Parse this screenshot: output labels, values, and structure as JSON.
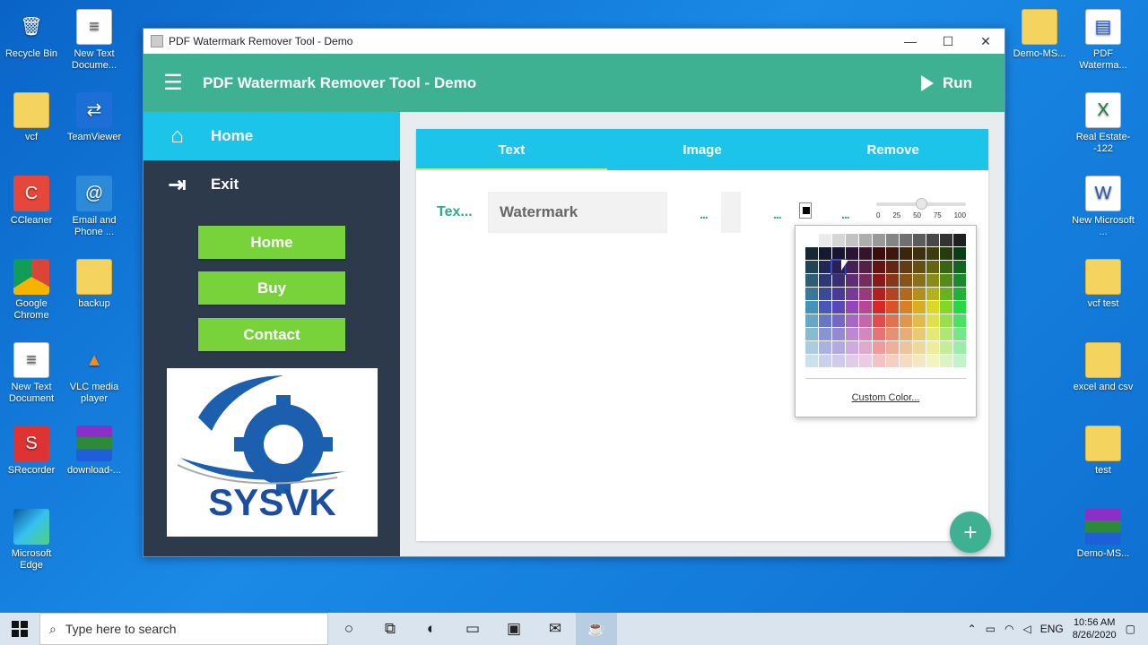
{
  "desktop": {
    "left_icons": [
      {
        "label": "Recycle Bin",
        "icon": "recycle-bin-icon"
      },
      {
        "label": "New Text Docume...",
        "icon": "text-document-icon"
      },
      {
        "label": "vcf",
        "icon": "folder-icon"
      },
      {
        "label": "TeamViewer",
        "icon": "teamviewer-icon"
      },
      {
        "label": "CCleaner",
        "icon": "ccleaner-icon"
      },
      {
        "label": "Email and Phone ...",
        "icon": "email-icon"
      },
      {
        "label": "Google Chrome",
        "icon": "chrome-icon"
      },
      {
        "label": "backup",
        "icon": "folder-icon"
      },
      {
        "label": "New Text Document",
        "icon": "text-document-icon"
      },
      {
        "label": "VLC media player",
        "icon": "vlc-icon"
      },
      {
        "label": "SRecorder",
        "icon": "srecorder-icon"
      },
      {
        "label": "download-...",
        "icon": "winrar-icon"
      },
      {
        "label": "Microsoft Edge",
        "icon": "edge-icon"
      }
    ],
    "right_icons": [
      {
        "label": "Demo-MS...",
        "icon": "folder-icon"
      },
      {
        "label": "PDF Waterma...",
        "icon": "pdf-icon"
      },
      {
        "label": "Real Estate--122",
        "icon": "excel-icon"
      },
      {
        "label": "New Microsoft ...",
        "icon": "word-icon"
      },
      {
        "label": "vcf test",
        "icon": "folder-icon"
      },
      {
        "label": "excel and csv",
        "icon": "folder-icon"
      },
      {
        "label": "test",
        "icon": "folder-icon"
      },
      {
        "label": "Demo-MS...",
        "icon": "winrar-icon"
      }
    ]
  },
  "window": {
    "title": "PDF Watermark Remover Tool - Demo",
    "controls": {
      "minimize": "—",
      "maximize": "☐",
      "close": "✕"
    }
  },
  "appbar": {
    "title": "PDF Watermark Remover Tool - Demo",
    "run_label": "Run"
  },
  "sidebar": {
    "nav": [
      {
        "label": "Home",
        "icon": "home-icon"
      },
      {
        "label": "Exit",
        "icon": "exit-icon"
      }
    ],
    "buttons": {
      "home": "Home",
      "buy": "Buy",
      "contact": "Contact"
    },
    "logo_text": "SYSVK"
  },
  "tabs": [
    {
      "label": "Text"
    },
    {
      "label": "Image"
    },
    {
      "label": "Remove"
    }
  ],
  "text_tab": {
    "field_label": "Tex...",
    "watermark_value": "Watermark",
    "more_1": "...",
    "more_2": "...",
    "more_3": "...",
    "selected_color": "#000000",
    "opacity": 0.5,
    "slider_ticks": [
      "0",
      "25",
      "50",
      "75",
      "100"
    ]
  },
  "palette": {
    "custom_color_label": "Custom Color...",
    "selected_color": "#1d2a8c"
  },
  "fab_label": "+",
  "taskbar": {
    "search_placeholder": "Type here to search",
    "tray_language": "ENG",
    "time": "10:56 AM",
    "date": "8/26/2020"
  },
  "colors": {
    "appbar": "#3db192",
    "tabs": "#1dc4e9",
    "sidebar": "#2c3a4b",
    "green_button": "#78d23a"
  }
}
